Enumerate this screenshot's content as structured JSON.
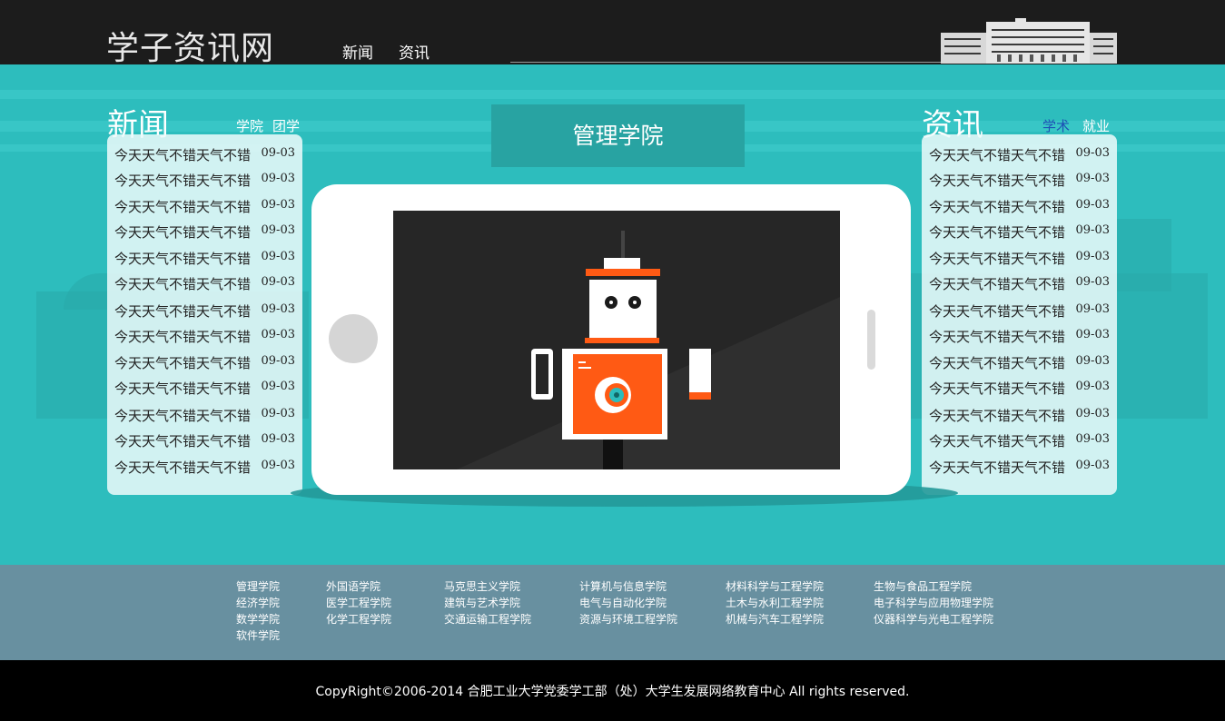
{
  "header": {
    "logo": "学子资讯网",
    "nav": [
      "新闻",
      "资讯"
    ]
  },
  "news": {
    "title": "新闻",
    "tabs": [
      "学院",
      "团学"
    ],
    "items": [
      {
        "text": "今天天气不错天气不错",
        "date": "09-03"
      },
      {
        "text": "今天天气不错天气不错",
        "date": "09-03"
      },
      {
        "text": "今天天气不错天气不错",
        "date": "09-03"
      },
      {
        "text": "今天天气不错天气不错",
        "date": "09-03"
      },
      {
        "text": "今天天气不错天气不错",
        "date": "09-03"
      },
      {
        "text": "今天天气不错天气不错",
        "date": "09-03"
      },
      {
        "text": "今天天气不错天气不错",
        "date": "09-03"
      },
      {
        "text": "今天天气不错天气不错",
        "date": "09-03"
      },
      {
        "text": "今天天气不错天气不错",
        "date": "09-03"
      },
      {
        "text": "今天天气不错天气不错",
        "date": "09-03"
      },
      {
        "text": "今天天气不错天气不错",
        "date": "09-03"
      },
      {
        "text": "今天天气不错天气不错",
        "date": "09-03"
      },
      {
        "text": "今天天气不错天气不错",
        "date": "09-03"
      }
    ]
  },
  "info": {
    "title": "资讯",
    "tabs": [
      "学术",
      "就业"
    ],
    "items": [
      {
        "text": "今天天气不错天气不错",
        "date": "09-03"
      },
      {
        "text": "今天天气不错天气不错",
        "date": "09-03"
      },
      {
        "text": "今天天气不错天气不错",
        "date": "09-03"
      },
      {
        "text": "今天天气不错天气不错",
        "date": "09-03"
      },
      {
        "text": "今天天气不错天气不错",
        "date": "09-03"
      },
      {
        "text": "今天天气不错天气不错",
        "date": "09-03"
      },
      {
        "text": "今天天气不错天气不错",
        "date": "09-03"
      },
      {
        "text": "今天天气不错天气不错",
        "date": "09-03"
      },
      {
        "text": "今天天气不错天气不错",
        "date": "09-03"
      },
      {
        "text": "今天天气不错天气不错",
        "date": "09-03"
      },
      {
        "text": "今天天气不错天气不错",
        "date": "09-03"
      },
      {
        "text": "今天天气不错天气不错",
        "date": "09-03"
      },
      {
        "text": "今天天气不错天气不错",
        "date": "09-03"
      }
    ]
  },
  "center": {
    "college": "管理学院"
  },
  "colleges": [
    [
      "管理学院",
      "经济学院",
      "数学学院",
      "软件学院"
    ],
    [
      "外国语学院",
      "医学工程学院",
      "化学工程学院"
    ],
    [
      "马克思主义学院",
      "建筑与艺术学院",
      "交通运输工程学院"
    ],
    [
      "计算机与信息学院",
      "电气与自动化学院",
      "资源与环境工程学院"
    ],
    [
      "材料科学与工程学院",
      "土木与水利工程学院",
      "机械与汽车工程学院"
    ],
    [
      "生物与食品工程学院",
      "电子科学与应用物理学院",
      "仪器科学与光电工程学院"
    ]
  ],
  "footer": {
    "copyright": "CopyRight©2006-2014 合肥工业大学党委学工部（处）大学生发展网络教育中心 All rights reserved."
  },
  "colors": {
    "header_bg": "#1c1c1c",
    "main_bg": "#2dbdbd",
    "links_bg": "#6890a0",
    "active_tab": "#1d50b5",
    "robot_orange": "#ff5a14"
  }
}
